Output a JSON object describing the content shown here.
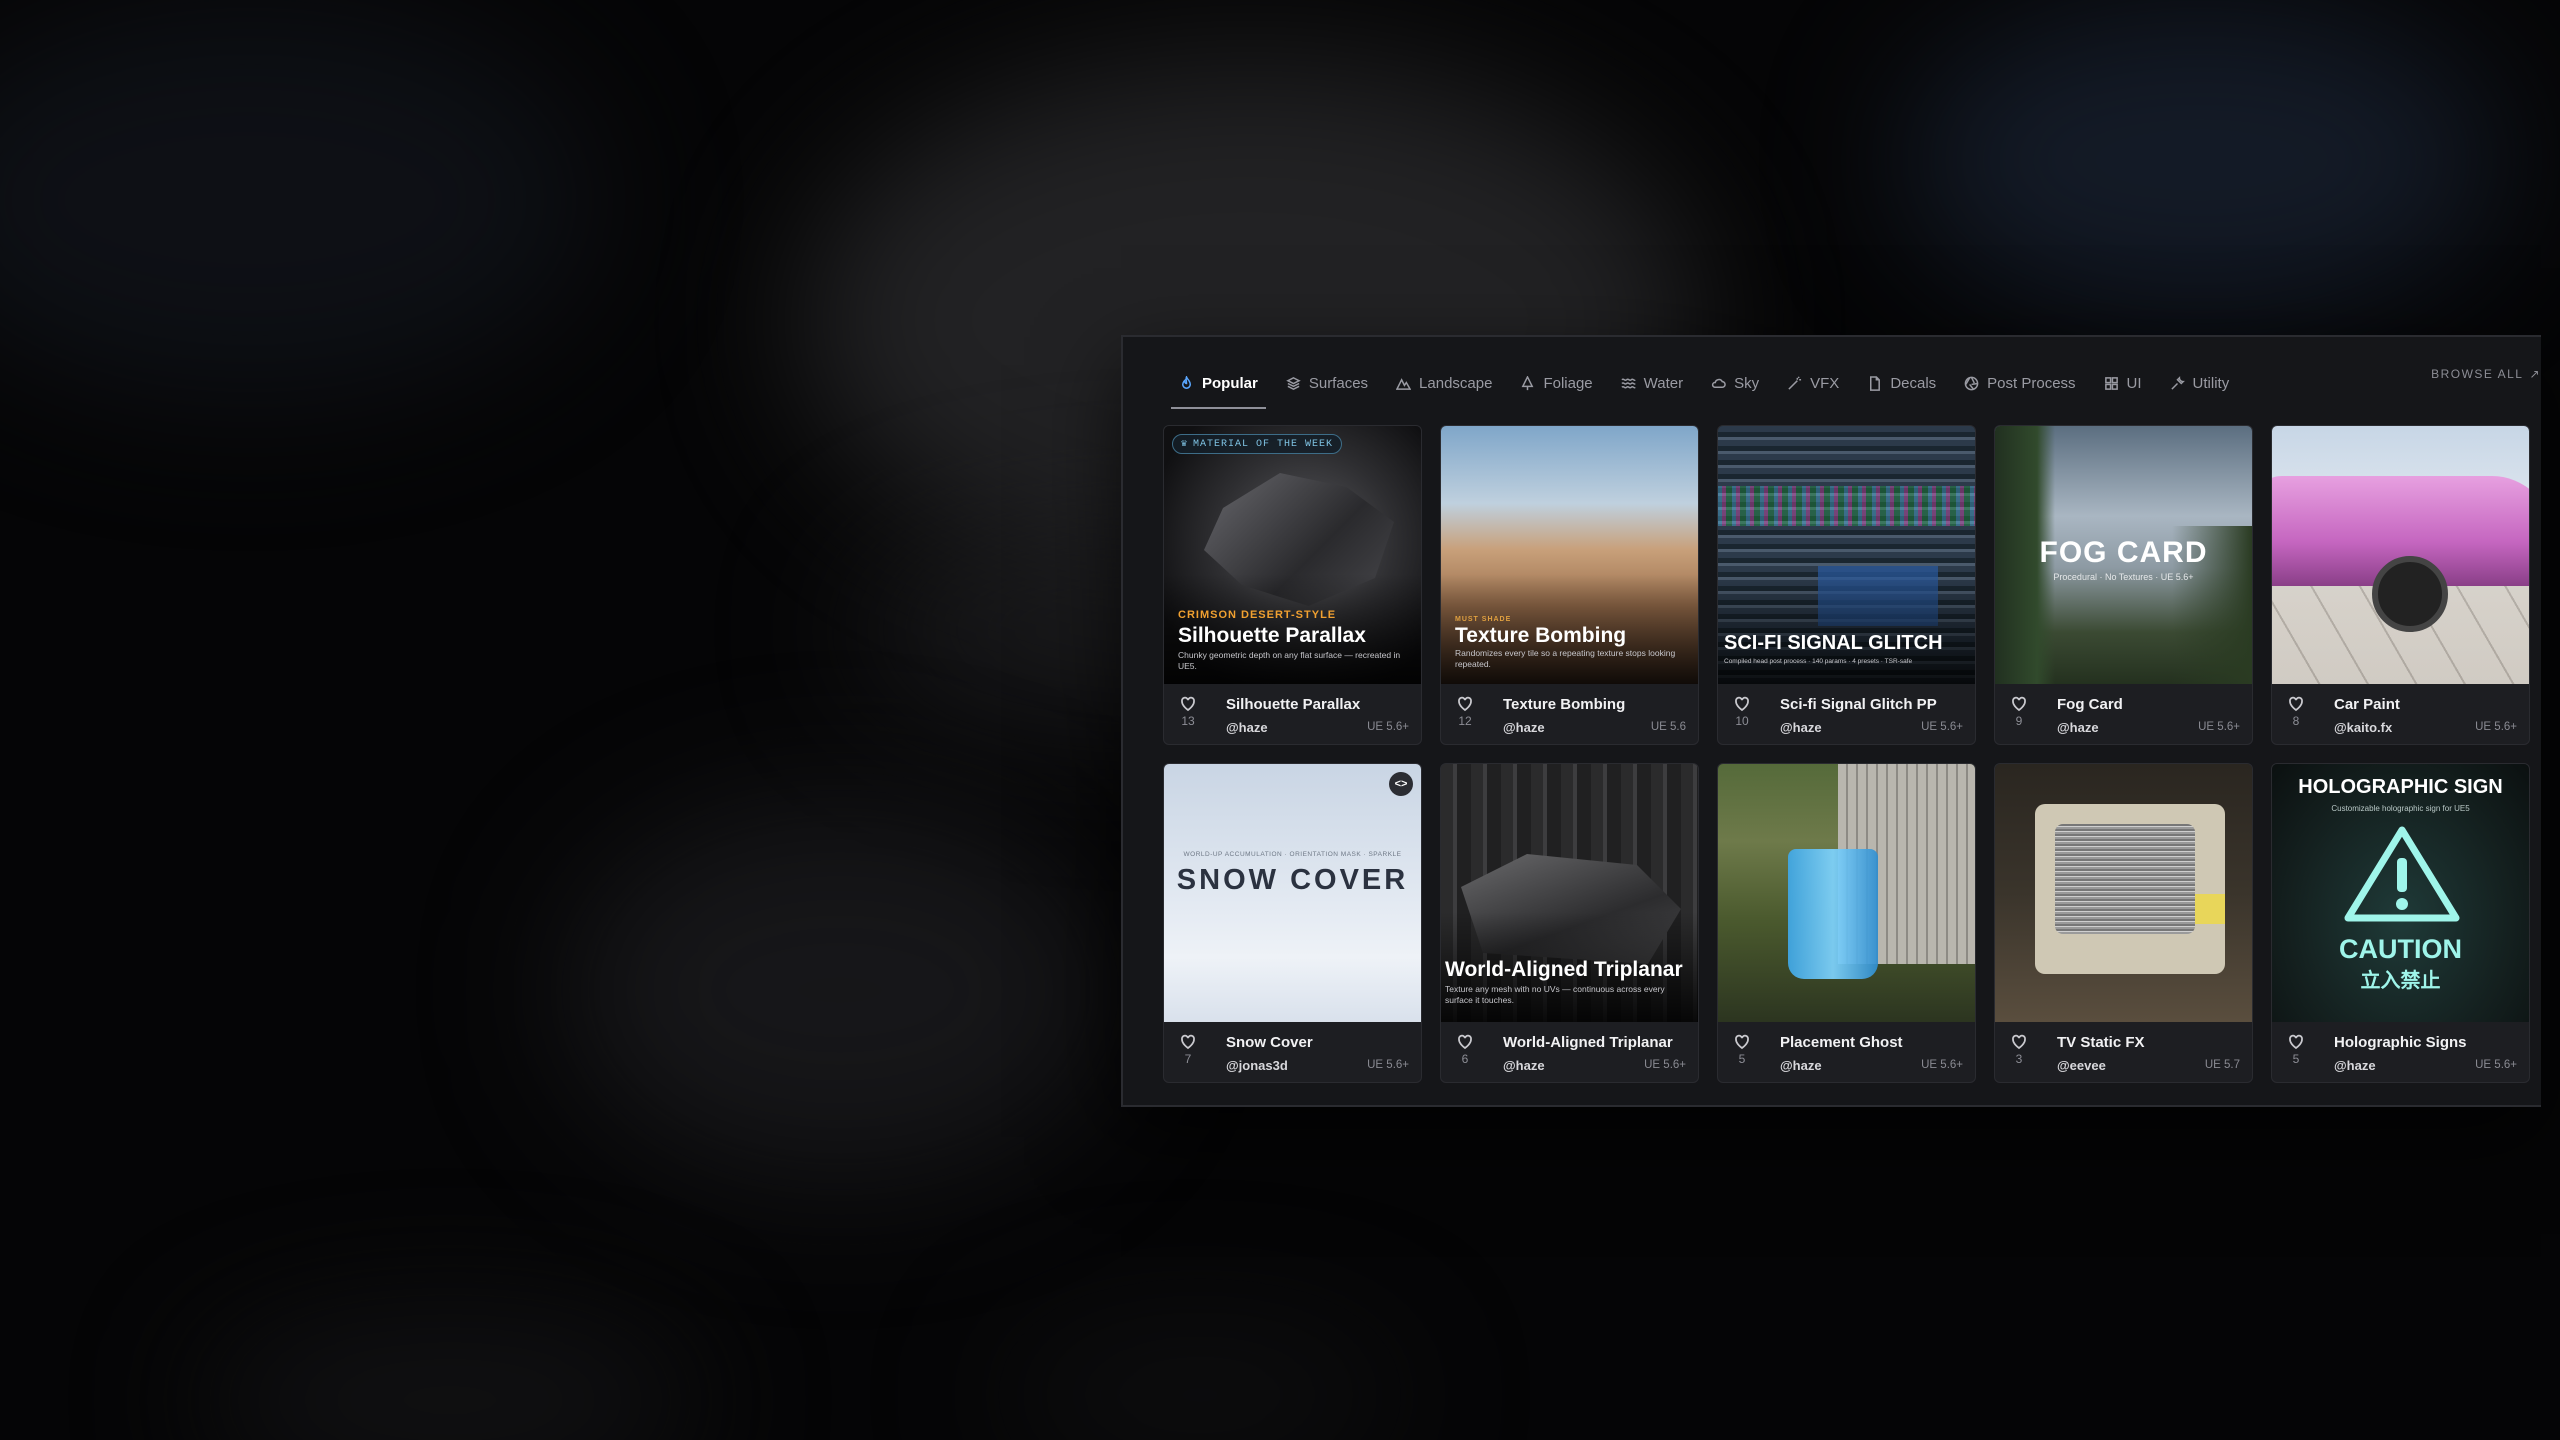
{
  "tabs": [
    {
      "label": "Popular",
      "icon": "flame-icon",
      "active": true
    },
    {
      "label": "Surfaces",
      "icon": "layers-icon"
    },
    {
      "label": "Landscape",
      "icon": "mountain-icon"
    },
    {
      "label": "Foliage",
      "icon": "tree-icon"
    },
    {
      "label": "Water",
      "icon": "waves-icon"
    },
    {
      "label": "Sky",
      "icon": "cloud-icon"
    },
    {
      "label": "VFX",
      "icon": "wand-icon"
    },
    {
      "label": "Decals",
      "icon": "file-icon"
    },
    {
      "label": "Post Process",
      "icon": "aperture-icon"
    },
    {
      "label": "UI",
      "icon": "grid-icon"
    },
    {
      "label": "Utility",
      "icon": "wrench-icon"
    }
  ],
  "browse_all": "BROWSE ALL",
  "cards": [
    {
      "name": "Silhouette Parallax",
      "author": "@haze",
      "version": "UE 5.6+",
      "likes": "13",
      "badge": "MATERIAL OF THE WEEK",
      "thumb_kicker": "CRIMSON DESERT-STYLE",
      "thumb_title": "Silhouette Parallax",
      "thumb_desc": "Chunky geometric depth on any flat surface — recreated in UE5."
    },
    {
      "name": "Texture Bombing",
      "author": "@haze",
      "version": "UE 5.6",
      "likes": "12",
      "thumb_kicker": "MUST SHADE",
      "thumb_title": "Texture Bombing",
      "thumb_desc": "Randomizes every tile so a repeating texture stops looking repeated."
    },
    {
      "name": "Sci-fi Signal Glitch PP",
      "author": "@haze",
      "version": "UE 5.6+",
      "likes": "10",
      "thumb_title": "SCI-FI SIGNAL GLITCH",
      "thumb_desc": "Compiled head post process · 140 params · 4 presets · TSR-safe"
    },
    {
      "name": "Fog Card",
      "author": "@haze",
      "version": "UE 5.6+",
      "likes": "9",
      "thumb_title": "FOG CARD",
      "thumb_desc": "Procedural · No Textures · UE 5.6+"
    },
    {
      "name": "Car Paint",
      "author": "@kaito.fx",
      "version": "UE 5.6+",
      "likes": "8"
    },
    {
      "name": "Snow Cover",
      "author": "@jonas3d",
      "version": "UE 5.6+",
      "likes": "7",
      "thumb_title": "SNOW COVER",
      "thumb_desc": "WORLD-UP ACCUMULATION · ORIENTATION MASK · SPARKLE"
    },
    {
      "name": "World-Aligned Triplanar",
      "author": "@haze",
      "version": "UE 5.6+",
      "likes": "6",
      "thumb_title": "World-Aligned Triplanar",
      "thumb_desc": "Texture any mesh with no UVs — continuous across every surface it touches."
    },
    {
      "name": "Placement Ghost",
      "author": "@haze",
      "version": "UE 5.6+",
      "likes": "5"
    },
    {
      "name": "TV Static FX",
      "author": "@eevee",
      "version": "UE 5.7",
      "likes": "3"
    },
    {
      "name": "Holographic Signs",
      "author": "@haze",
      "version": "UE 5.6+",
      "likes": "5",
      "thumb_title": "HOLOGRAPHIC SIGN",
      "thumb_desc": "Customizable holographic sign for UE5",
      "thumb_caution": "CAUTION",
      "thumb_jp": "立入禁止"
    }
  ]
}
